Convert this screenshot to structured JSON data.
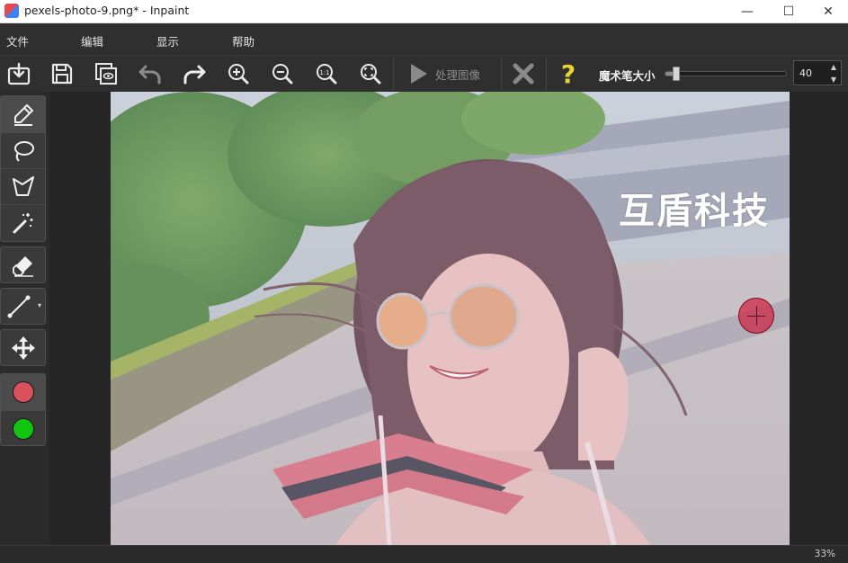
{
  "window": {
    "title": "pexels-photo-9.png* - Inpaint",
    "minimize_glyph": "—",
    "maximize_glyph": "☐",
    "close_glyph": "✕"
  },
  "menu": [
    "文件",
    "编辑",
    "显示",
    "帮助"
  ],
  "toolbar": {
    "process_label": "处理图像",
    "brush_size_label": "魔术笔大小",
    "brush_size_value": "40",
    "brush_size_fraction": 0.09,
    "spin_up": "▲",
    "spin_down": "▼",
    "icons": [
      "open-icon",
      "save-icon",
      "preview-icon",
      "undo-icon",
      "redo-icon",
      "zoom-in-icon",
      "zoom-out-icon",
      "zoom-actual-icon",
      "zoom-fit-icon",
      "play-icon",
      "cancel-icon",
      "help-icon"
    ]
  },
  "tools": {
    "icons": [
      "marker-icon",
      "lasso-icon",
      "polygon-lasso-icon",
      "magic-wand-icon",
      "eraser-icon",
      "line-icon",
      "move-icon"
    ],
    "mask_color": "#d9515a",
    "donor_color": "#11c511"
  },
  "canvas": {
    "watermark": "互盾科技"
  },
  "status": {
    "zoom": "33%"
  },
  "colors": {
    "background": "#2b2b2b",
    "panel": "#3a3a3a",
    "help_accent": "#e8d334",
    "mask_overlay": "#cd2846"
  }
}
